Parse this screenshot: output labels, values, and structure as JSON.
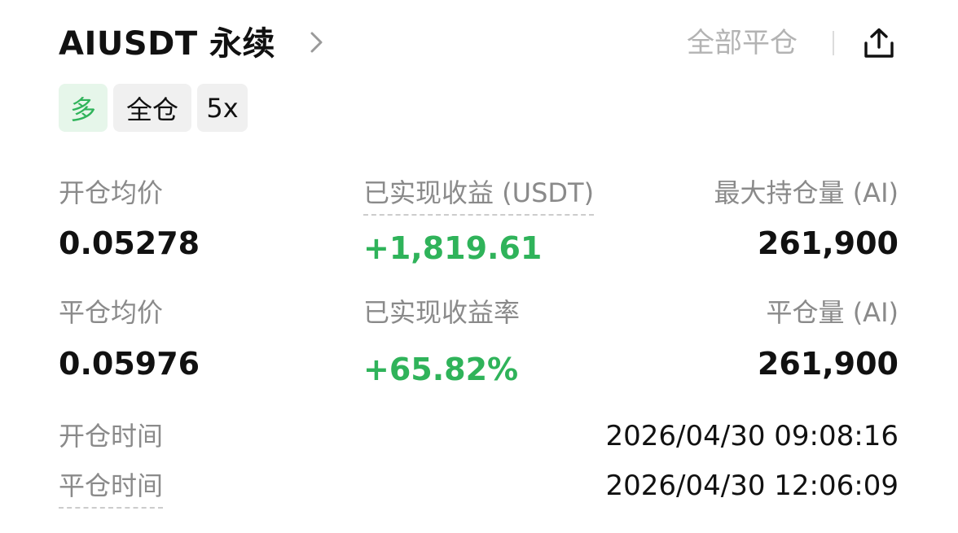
{
  "header": {
    "title": "AIUSDT 永续",
    "close_all_label": "全部平仓"
  },
  "badges": {
    "side": "多",
    "margin_mode": "全仓",
    "leverage": "5x"
  },
  "stats": {
    "open_avg_price_label": "开仓均价",
    "open_avg_price": "0.05278",
    "realized_pnl_label": "已实现收益 (USDT)",
    "realized_pnl": "+1,819.61",
    "max_position_label": "最大持仓量 (AI)",
    "max_position": "261,900",
    "close_avg_price_label": "平仓均价",
    "close_avg_price": "0.05976",
    "realized_pnl_rate_label": "已实现收益率",
    "realized_pnl_rate": "+65.82%",
    "closed_amount_label": "平仓量 (AI)",
    "closed_amount": "261,900"
  },
  "times": {
    "open_time_label": "开仓时间",
    "open_time": "2026/04/30 09:08:16",
    "close_time_label": "平仓时间",
    "close_time": "2026/04/30 12:06:09"
  },
  "icons": {
    "chevron": "chevron-right-icon",
    "share": "share-icon"
  },
  "colors": {
    "profit_green": "#2fb35a",
    "long_badge_bg": "#e6f6ea",
    "muted_text": "#8a8a8a",
    "disabled_text": "#b3b3b3"
  }
}
